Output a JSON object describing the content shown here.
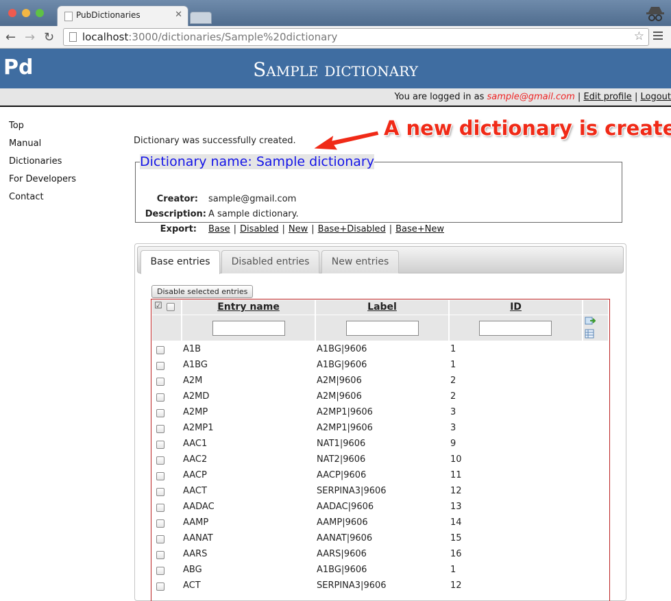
{
  "browser": {
    "tab_title": "PubDictionaries",
    "url_host": "localhost",
    "url_path": ":3000/dictionaries/Sample%20dictionary"
  },
  "header": {
    "logo": "Pd",
    "title": "Sample dictionary"
  },
  "userbar": {
    "prefix": "You are logged in as",
    "email": "sample@gmail.com",
    "edit_profile": "Edit profile",
    "logout": "Logout",
    "separator": "|"
  },
  "sidebar": {
    "items": [
      "Top",
      "Manual",
      "Dictionaries",
      "For Developers",
      "Contact"
    ]
  },
  "flash": "Dictionary was successfully created.",
  "annotation": "A new dictionary is created",
  "dictionary": {
    "legend": "Dictionary name: Sample dictionary",
    "creator_label": "Creator:",
    "creator": "sample@gmail.com",
    "description_label": "Description:",
    "description": "A sample dictionary.",
    "export_label": "Export:",
    "export_links": [
      "Base",
      "Disabled",
      "New",
      "Base+Disabled",
      "Base+New"
    ]
  },
  "entries": {
    "tabs": [
      "Base entries",
      "Disabled entries",
      "New entries"
    ],
    "disable_button": "Disable selected entries",
    "columns": [
      "Entry name",
      "Label",
      "ID"
    ],
    "check_mark": "☑",
    "rows": [
      [
        "A1B",
        "A1BG|9606",
        "1"
      ],
      [
        "A1BG",
        "A1BG|9606",
        "1"
      ],
      [
        "A2M",
        "A2M|9606",
        "2"
      ],
      [
        "A2MD",
        "A2M|9606",
        "2"
      ],
      [
        "A2MP",
        "A2MP1|9606",
        "3"
      ],
      [
        "A2MP1",
        "A2MP1|9606",
        "3"
      ],
      [
        "AAC1",
        "NAT1|9606",
        "9"
      ],
      [
        "AAC2",
        "NAT2|9606",
        "10"
      ],
      [
        "AACP",
        "AACP|9606",
        "11"
      ],
      [
        "AACT",
        "SERPINA3|9606",
        "12"
      ],
      [
        "AADAC",
        "AADAC|9606",
        "13"
      ],
      [
        "AAMP",
        "AAMP|9606",
        "14"
      ],
      [
        "AANAT",
        "AANAT|9606",
        "15"
      ],
      [
        "AARS",
        "AARS|9606",
        "16"
      ],
      [
        "ABG",
        "A1BG|9606",
        "1"
      ],
      [
        "ACT",
        "SERPINA3|9606",
        "12"
      ]
    ]
  },
  "colors": {
    "header_bg": "#3f6da1",
    "legend_text": "#1313e8",
    "annotation": "#f02a17",
    "email": "#ee2222",
    "grid_border": "#bb2222"
  }
}
